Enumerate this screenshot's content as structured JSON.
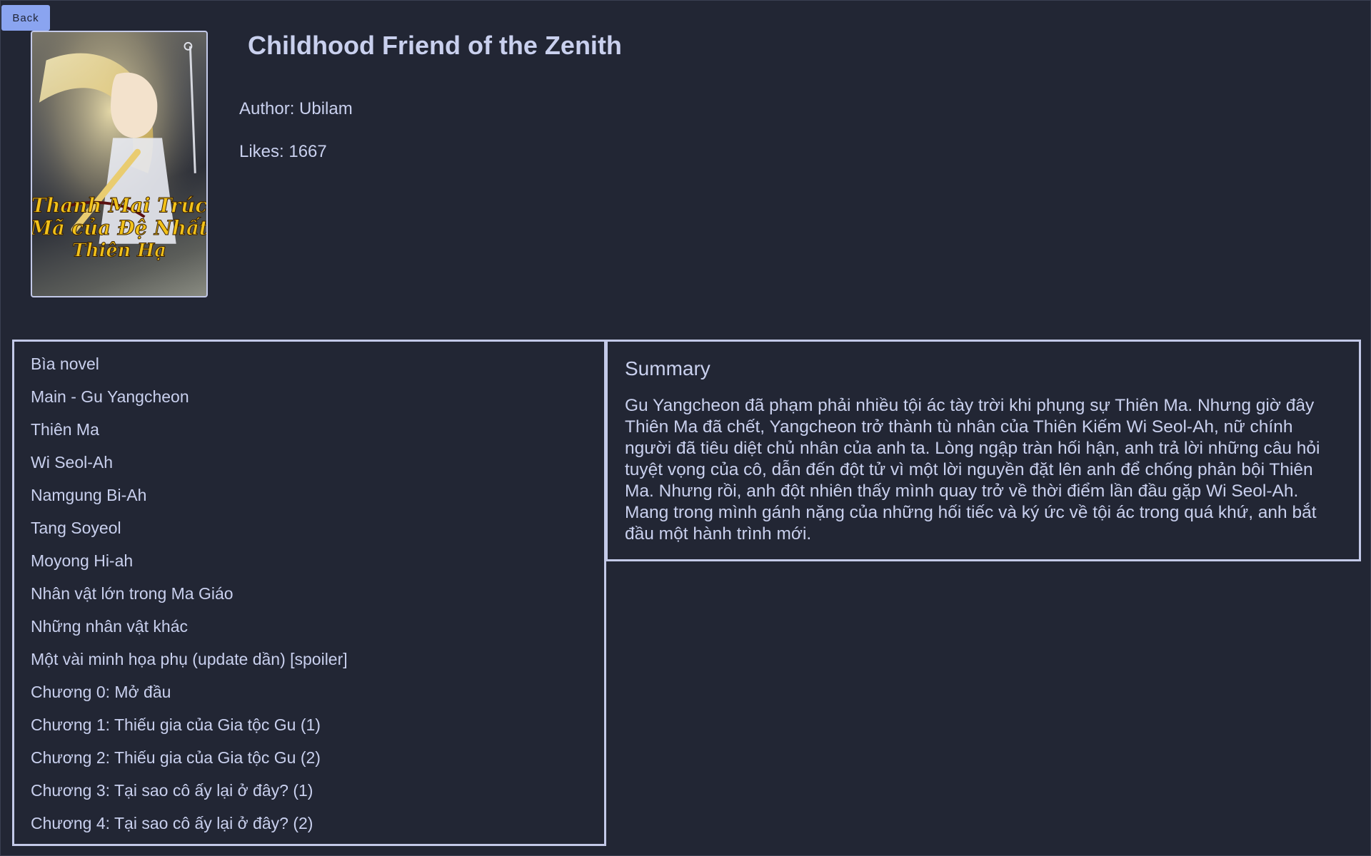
{
  "back_label": "Back",
  "novel": {
    "title": "Childhood Friend of the Zenith",
    "author_text": "Author: Ubilam",
    "likes_text": "Likes: 1667",
    "cover_lettering": "Thanh Mai Trúc Mã của Đệ Nhất Thiên Hạ"
  },
  "chapters": [
    "Bìa novel",
    "Main - Gu Yangcheon",
    "Thiên Ma",
    "Wi Seol-Ah",
    "Namgung Bi-Ah",
    "Tang Soyeol",
    "Moyong Hi-ah",
    "Nhân vật lớn trong Ma Giáo",
    "Những nhân vật khác",
    "Một vài minh họa phụ (update dần) [spoiler]",
    "Chương 0: Mở đầu",
    "Chương 1: Thiếu gia của Gia tộc Gu (1)",
    "Chương 2: Thiếu gia của Gia tộc Gu (2)",
    "Chương 3: Tại sao cô ấy lại ở đây? (1)",
    "Chương 4: Tại sao cô ấy lại ở đây? (2)"
  ],
  "summary": {
    "heading": "Summary",
    "text": "Gu Yangcheon đã phạm phải nhiều tội ác tày trời khi phụng sự Thiên Ma. Nhưng giờ đây Thiên Ma đã chết, Yangcheon trở thành tù nhân của Thiên Kiếm Wi Seol-Ah, nữ chính người đã tiêu diệt chủ nhân của anh ta. Lòng ngập tràn hối hận, anh trả lời những câu hỏi tuyệt vọng của cô, dẫn đến đột tử vì một lời nguyền đặt lên anh để chống phản bội Thiên Ma. Nhưng rồi, anh đột nhiên thấy mình quay trở về thời điểm lần đầu gặp Wi Seol-Ah. Mang trong mình gánh nặng của những hối tiếc và ký ức về tội ác trong quá khứ, anh bắt đầu một hành trình mới."
  },
  "colors": {
    "background": "#222634",
    "text": "#c9d0ee",
    "border": "#c3c9e8",
    "button": "#8aa4f0"
  }
}
